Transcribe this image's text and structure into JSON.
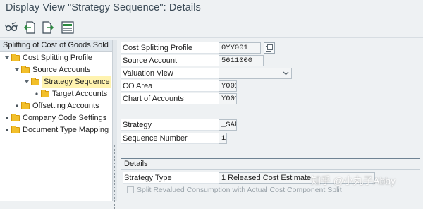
{
  "window": {
    "title": "Display View \"Strategy Sequence\": Details"
  },
  "toolbar": {
    "buttons": [
      {
        "icon": "glasses-icon"
      },
      {
        "icon": "previous-entry-icon"
      },
      {
        "icon": "next-entry-icon"
      },
      {
        "icon": "variable-list-icon"
      }
    ]
  },
  "tree": {
    "header": "Splitting of Cost of Goods Sold",
    "nodes": [
      {
        "label": "Cost Splitting Profile",
        "expanded": true
      },
      {
        "label": "Source Accounts",
        "expanded": true
      },
      {
        "label": "Strategy Sequence",
        "expanded": true,
        "selected": true
      },
      {
        "label": "Target Accounts"
      },
      {
        "label": "Offsetting Accounts"
      },
      {
        "label": "Company Code Settings"
      },
      {
        "label": "Document Type Mapping"
      }
    ]
  },
  "form": {
    "cost_splitting_profile": {
      "label": "Cost Splitting Profile",
      "value": "0YY001"
    },
    "source_account": {
      "label": "Source Account",
      "value": "5611000"
    },
    "valuation_view": {
      "label": "Valuation View",
      "value": ""
    },
    "co_area": {
      "label": "CO Area",
      "value": "Y001"
    },
    "chart_of_accounts": {
      "label": "Chart of Accounts",
      "value": "Y001"
    },
    "strategy": {
      "label": "Strategy",
      "value": "_SAP"
    },
    "sequence_number": {
      "label": "Sequence Number",
      "value": "1"
    }
  },
  "details": {
    "title": "Details",
    "strategy_type": {
      "label": "Strategy Type",
      "value": "1 Released Cost Estimate"
    },
    "split_checkbox": {
      "label": "Split Revalued Consumption with Actual Cost Component Split",
      "checked": false
    }
  },
  "watermark": "知乎 @小丸子Abby"
}
